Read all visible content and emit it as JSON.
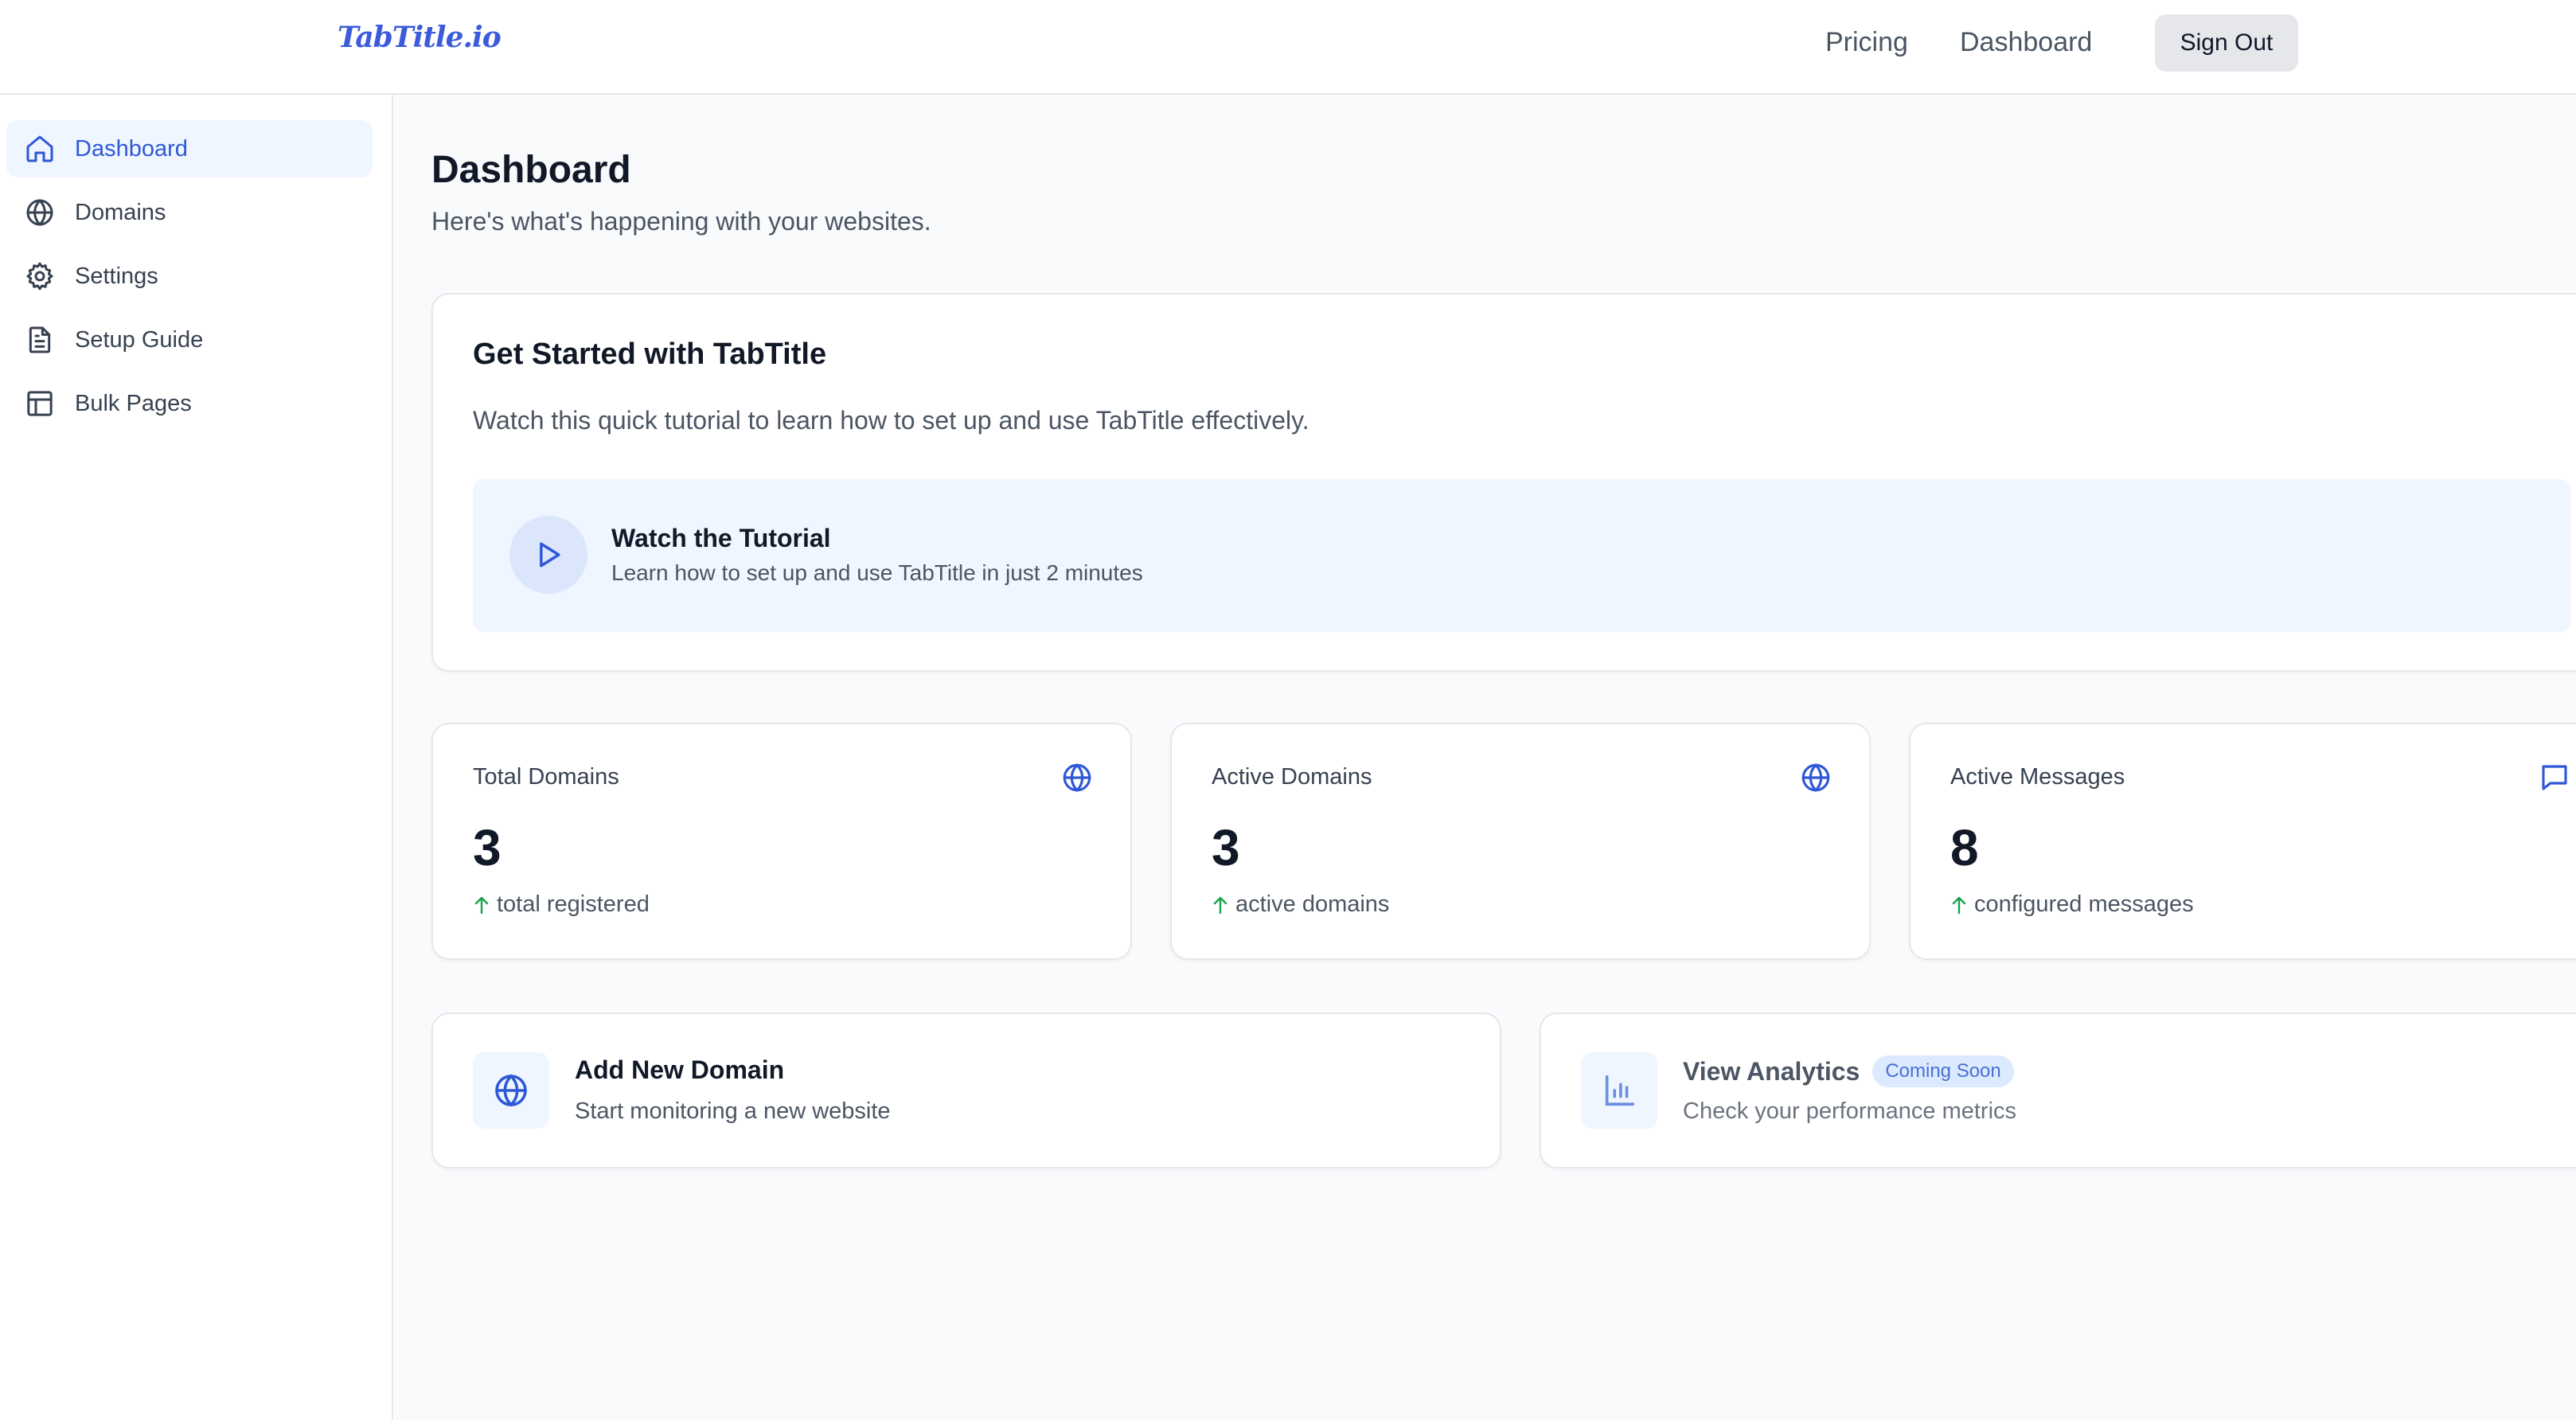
{
  "brand": {
    "logo_text": "TabTitle.io",
    "accent": "#2f58d6",
    "success": "#16a34a"
  },
  "topnav": {
    "pricing": "Pricing",
    "dashboard": "Dashboard",
    "sign_out": "Sign Out"
  },
  "sidebar": {
    "items": [
      {
        "label": "Dashboard",
        "icon": "home-icon",
        "active": true
      },
      {
        "label": "Domains",
        "icon": "globe-icon"
      },
      {
        "label": "Settings",
        "icon": "gear-icon"
      },
      {
        "label": "Setup Guide",
        "icon": "document-icon"
      },
      {
        "label": "Bulk Pages",
        "icon": "table-icon"
      }
    ]
  },
  "main": {
    "title": "Dashboard",
    "subtitle": "Here's what's happening with your websites.",
    "get_started": {
      "title": "Get Started with TabTitle",
      "description": "Watch this quick tutorial to learn how to set up and use TabTitle effectively.",
      "tutorial_title": "Watch the Tutorial",
      "tutorial_subtitle": "Learn how to set up and use TabTitle in just 2 minutes"
    },
    "stats": [
      {
        "label": "Total Domains",
        "value": "3",
        "foot": "total registered",
        "icon": "globe-icon"
      },
      {
        "label": "Active Domains",
        "value": "3",
        "foot": "active domains",
        "icon": "globe-icon"
      },
      {
        "label": "Active Messages",
        "value": "8",
        "foot": "configured messages",
        "icon": "message-icon"
      }
    ],
    "actions": [
      {
        "title": "Add New Domain",
        "subtitle": "Start monitoring a new website",
        "icon": "globe-icon"
      },
      {
        "title": "View Analytics",
        "badge": "Coming Soon",
        "subtitle": "Check your performance metrics",
        "icon": "bar-chart-icon"
      }
    ]
  }
}
